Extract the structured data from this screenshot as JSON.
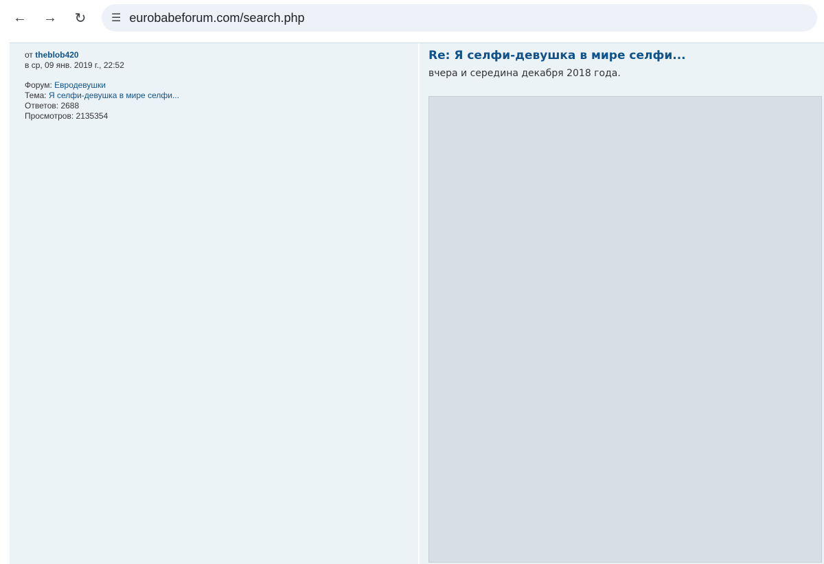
{
  "browser": {
    "back_icon": "arrow-left-icon",
    "forward_icon": "arrow-right-icon",
    "reload_icon": "reload-icon",
    "site_info_icon": "tune-icon",
    "url": "eurobabeforum.com/search.php"
  },
  "post": {
    "author_prefix": "от",
    "author": "theblob420",
    "date": "в ср, 09 янв. 2019 г., 22:52",
    "forum_label": "Форум:",
    "forum": "Евродевушки",
    "topic_label": "Тема:",
    "topic": "Я селфи-девушка в мире селфи...",
    "replies_label": "Ответов:",
    "replies": "2688",
    "views_label": "Просмотров:",
    "views": "2135354",
    "title": "Re: Я селфи-девушка в мире селфи...",
    "text": "вчера и середина декабря 2018 года."
  },
  "colors": {
    "link": "#105289",
    "panel": "#ecf3f7",
    "omnibox": "#eef1f8"
  }
}
